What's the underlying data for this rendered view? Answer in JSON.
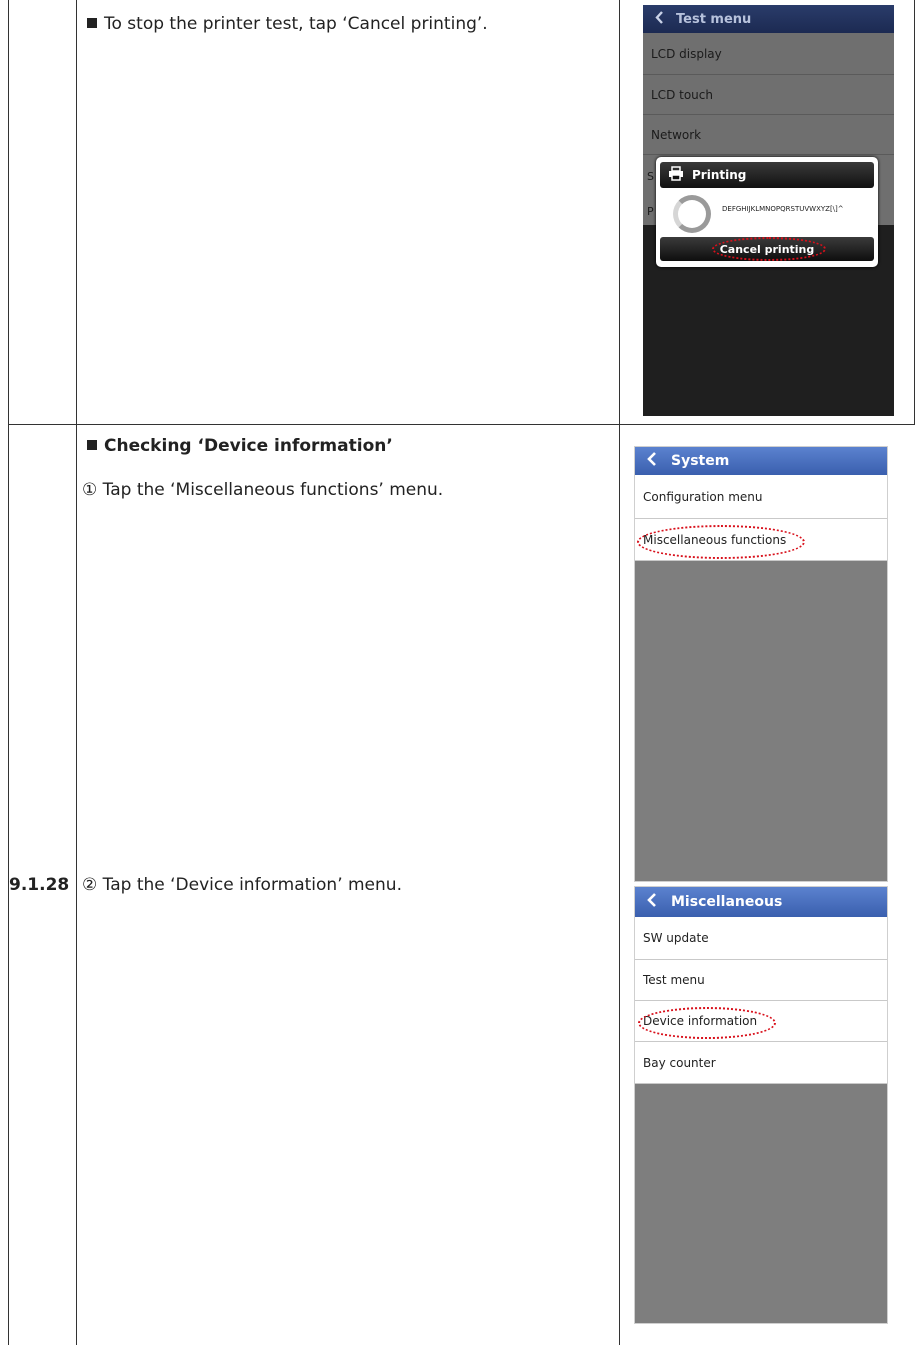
{
  "section_number": "9.1.28",
  "row1": {
    "instruction": "To stop the printer test, tap ‘Cancel printing’.",
    "screen": {
      "title": "Test menu",
      "items": [
        "LCD display",
        "LCD touch",
        "Network"
      ],
      "dialog": {
        "title": "Printing",
        "text": "DEFGHIJKLMNOPQRSTUVWXYZ[\\]^",
        "cancel_label": "Cancel printing"
      }
    }
  },
  "row2": {
    "heading": "Checking ‘Device information’",
    "step1": "① Tap the ‘Miscellaneous functions’ menu.",
    "step2": "② Tap the ‘Device information’ menu.",
    "screen1": {
      "title": "System",
      "items": [
        "Configuration menu",
        "Miscellaneous functions"
      ]
    },
    "screen2": {
      "title": "Miscellaneous",
      "items": [
        "SW update",
        "Test menu",
        "Device information",
        "Bay counter"
      ]
    }
  },
  "colors": {
    "titlebar_blue": "#3f64b4",
    "highlight_red": "#d8101b",
    "empty_area_gray": "#7e7e7e"
  }
}
